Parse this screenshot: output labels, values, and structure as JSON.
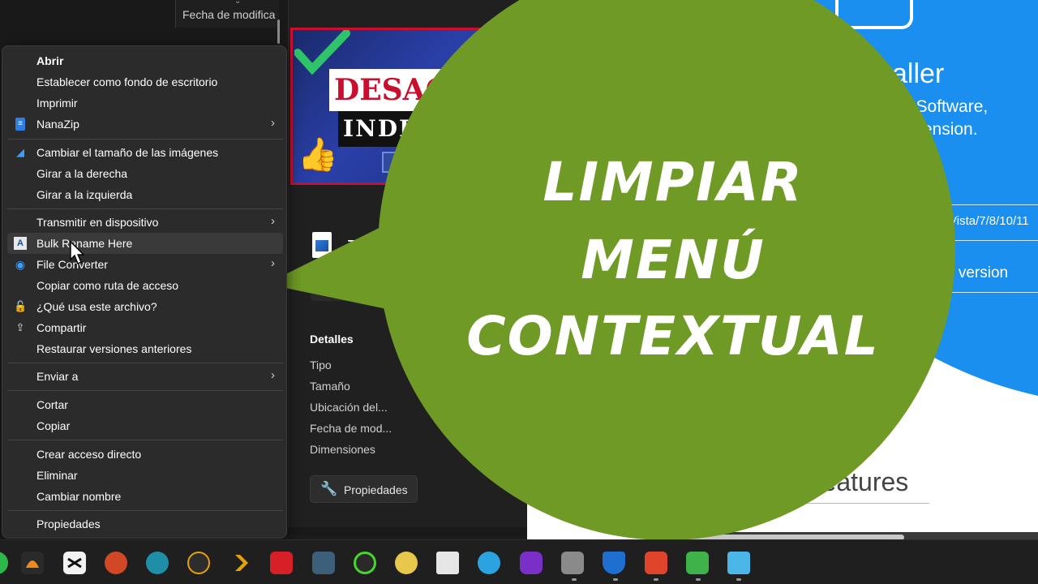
{
  "explorer": {
    "column_header": "Fecha de modifica",
    "file_name": "TUTO",
    "thumbnail_line1": "DESACTIV",
    "thumbnail_line2": "INDEX",
    "details": {
      "title": "Detalles",
      "labels": [
        "Tipo",
        "Tamaño",
        "Ubicación del...",
        "Fecha de mod...",
        "Dimensiones"
      ],
      "properties_button": "Propiedades"
    }
  },
  "web": {
    "heading": "aller",
    "line1": "n Software,",
    "line2": "tension.",
    "os_text": "Vista/7/8/10/11",
    "version_link": "e version",
    "features": "Features"
  },
  "overlay": {
    "line1": "LIMPIAR",
    "line2": "MENÚ",
    "line3": "CONTEXTUAL",
    "color": "#6f9a25"
  },
  "context_menu": {
    "items": [
      {
        "label": "Abrir",
        "icon": "",
        "bold": true
      },
      {
        "label": "Establecer como fondo de escritorio",
        "icon": ""
      },
      {
        "label": "Imprimir",
        "icon": ""
      },
      {
        "label": "NanaZip",
        "icon": "nanazip-icon",
        "submenu": true
      },
      {
        "label": "Cambiar el tamaño de las imágenes",
        "icon": "image-resizer-icon"
      },
      {
        "label": "Girar a la derecha",
        "icon": ""
      },
      {
        "label": "Girar a la izquierda",
        "icon": ""
      },
      {
        "label": "Transmitir en dispositivo",
        "icon": "",
        "submenu": true
      },
      {
        "label": "Bulk Rename Here",
        "icon": "bulk-rename-icon",
        "hover": true
      },
      {
        "label": "File Converter",
        "icon": "file-converter-icon",
        "submenu": true
      },
      {
        "label": "Copiar como ruta de acceso",
        "icon": ""
      },
      {
        "label": "¿Qué usa este archivo?",
        "icon": "lock-icon"
      },
      {
        "label": "Compartir",
        "icon": "share-icon"
      },
      {
        "label": "Restaurar versiones anteriores",
        "icon": ""
      },
      {
        "label": "Enviar a",
        "icon": "",
        "submenu": true
      },
      {
        "label": "Cortar",
        "icon": ""
      },
      {
        "label": "Copiar",
        "icon": ""
      },
      {
        "label": "Crear acceso directo",
        "icon": ""
      },
      {
        "label": "Eliminar",
        "icon": ""
      },
      {
        "label": "Cambiar nombre",
        "icon": ""
      },
      {
        "label": "Propiedades",
        "icon": ""
      }
    ],
    "submenu_glyph": "›"
  },
  "taskbar": {
    "apps": [
      "fl-studio-icon",
      "capcut-icon",
      "powerpoint-icon",
      "keyboard-app-icon",
      "plex-icon",
      "plex-arrow-icon",
      "camera-app-icon",
      "keyboard-icon",
      "razer-icon",
      "emoji-app-icon",
      "font-icon",
      "telegram-icon",
      "vr-icon",
      "network-icon",
      "defender-icon",
      "camtasia-red-icon",
      "camtasia-green-icon",
      "recycle-bin-icon"
    ]
  }
}
